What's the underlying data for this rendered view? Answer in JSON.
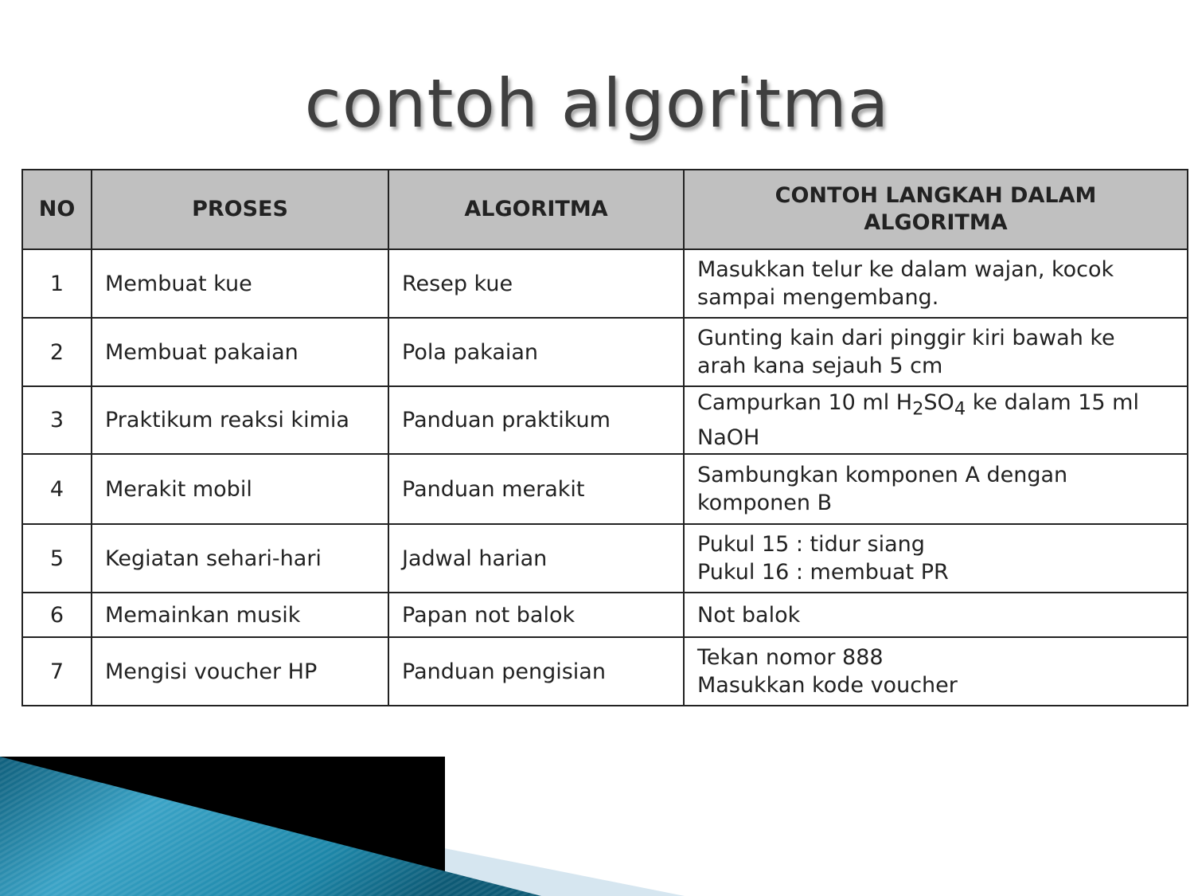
{
  "title": "contoh algoritma",
  "table": {
    "headers": {
      "no": "NO",
      "proses": "PROSES",
      "algoritma": "ALGORITMA",
      "contoh_line1": "CONTOH LANGKAH DALAM",
      "contoh_line2": "ALGORITMA"
    },
    "rows": [
      {
        "no": "1",
        "proses": "Membuat kue",
        "algoritma": "Resep kue",
        "contoh": [
          "Masukkan telur ke dalam wajan, kocok",
          "sampai mengembang."
        ]
      },
      {
        "no": "2",
        "proses": "Membuat pakaian",
        "algoritma": "Pola pakaian",
        "contoh": [
          "Gunting kain dari pinggir kiri bawah ke",
          "arah kana sejauh 5 cm"
        ]
      },
      {
        "no": "3",
        "proses": "Praktikum reaksi kimia",
        "algoritma": "Panduan praktikum",
        "contoh": [
          "Campurkan 10 ml H",
          "2",
          "SO",
          "4",
          " ke dalam 15 ml",
          "NaOH"
        ]
      },
      {
        "no": "4",
        "proses": "Merakit mobil",
        "algoritma": "Panduan merakit",
        "contoh": [
          "Sambungkan komponen A dengan",
          "komponen B"
        ]
      },
      {
        "no": "5",
        "proses": "Kegiatan sehari-hari",
        "algoritma": "Jadwal harian",
        "contoh": [
          "Pukul 15 : tidur siang",
          "Pukul 16 : membuat PR"
        ]
      },
      {
        "no": "6",
        "proses": "Memainkan musik",
        "algoritma": "Papan not balok",
        "contoh": [
          "Not balok"
        ]
      },
      {
        "no": "7",
        "proses": "Mengisi voucher HP",
        "algoritma": "Panduan pengisian",
        "contoh": [
          "Tekan nomor 888",
          "Masukkan kode voucher"
        ]
      }
    ]
  },
  "colors": {
    "header_bg": "#c0c0c0",
    "title_text": "#3f3f3f",
    "accent_teal": "#1d7fa0",
    "accent_light": "#d6e6f0",
    "accent_black": "#000000"
  }
}
